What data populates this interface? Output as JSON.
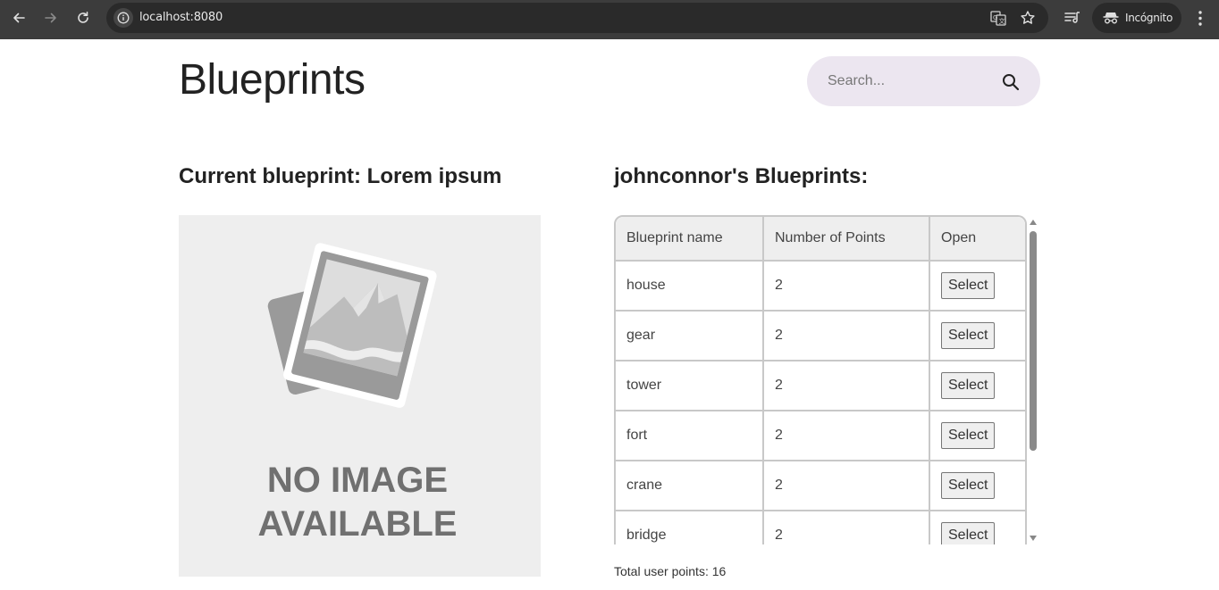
{
  "browser": {
    "url": "localhost:8080",
    "profile_label": "Incógnito",
    "icons": [
      "back-arrow-icon",
      "forward-arrow-icon",
      "reload-icon",
      "site-info-icon",
      "translate-icon",
      "bookmark-star-icon",
      "tab-search-icon",
      "incognito-icon",
      "menu-kebab-icon"
    ]
  },
  "header": {
    "title": "Blueprints",
    "search_placeholder": "Search...",
    "search_icon": "search-icon"
  },
  "current": {
    "heading": "Current blueprint: Lorem ipsum",
    "no_image_line1": "NO IMAGE",
    "no_image_line2": "AVAILABLE"
  },
  "user_blueprints": {
    "heading": "johnconnor's Blueprints:",
    "columns": [
      "Blueprint name",
      "Number of Points",
      "Open"
    ],
    "rows": [
      {
        "name": "house",
        "points": "2",
        "action": "Select"
      },
      {
        "name": "gear",
        "points": "2",
        "action": "Select"
      },
      {
        "name": "tower",
        "points": "2",
        "action": "Select"
      },
      {
        "name": "fort",
        "points": "2",
        "action": "Select"
      },
      {
        "name": "crane",
        "points": "2",
        "action": "Select"
      },
      {
        "name": "bridge",
        "points": "2",
        "action": "Select"
      }
    ],
    "total": "Total user points: 16"
  },
  "colors": {
    "chrome_bg": "#3c3c3c",
    "omnibox_bg": "#2a2a2a",
    "search_bg": "#ece6f0",
    "table_border": "#c8c8c8",
    "header_cell_bg": "#eeeeee",
    "placeholder_bg": "#eeeeee",
    "placeholder_text": "#707070"
  }
}
